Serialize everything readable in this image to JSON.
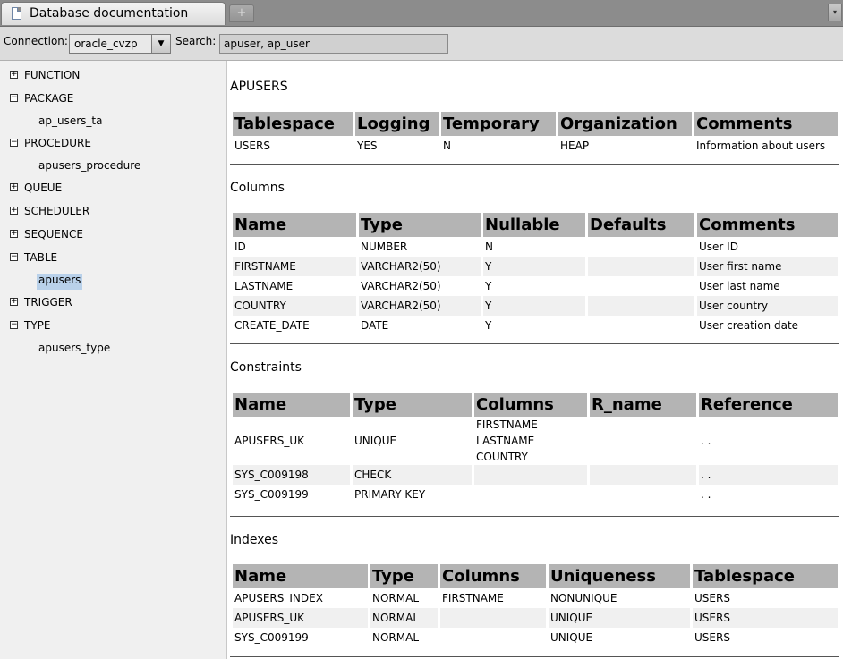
{
  "window": {
    "tab_title": "Database documentation",
    "new_tab": "+",
    "menu": "▾"
  },
  "toolbar": {
    "connection_label": "Connection:",
    "connection_value": "oracle_cvzp",
    "search_label": "Search:",
    "search_value": "apuser, ap_user"
  },
  "tree": {
    "nodes": [
      {
        "label": "FUNCTION",
        "expanded": false,
        "children": []
      },
      {
        "label": "PACKAGE",
        "expanded": true,
        "children": [
          "ap_users_ta"
        ]
      },
      {
        "label": "PROCEDURE",
        "expanded": true,
        "children": [
          "apusers_procedure"
        ]
      },
      {
        "label": "QUEUE",
        "expanded": false,
        "children": []
      },
      {
        "label": "SCHEDULER",
        "expanded": false,
        "children": []
      },
      {
        "label": "SEQUENCE",
        "expanded": false,
        "children": []
      },
      {
        "label": "TABLE",
        "expanded": true,
        "children": [
          "apusers"
        ]
      },
      {
        "label": "TRIGGER",
        "expanded": false,
        "children": []
      },
      {
        "label": "TYPE",
        "expanded": true,
        "children": [
          "apusers_type"
        ]
      }
    ],
    "selected": "apusers"
  },
  "doc": {
    "title": "APUSERS",
    "table_info": {
      "headers": [
        "Tablespace",
        "Logging",
        "Temporary",
        "Organization",
        "Comments"
      ],
      "rows": [
        [
          "USERS",
          "YES",
          "N",
          "HEAP",
          "Information about users"
        ]
      ]
    },
    "columns": {
      "title": "Columns",
      "headers": [
        "Name",
        "Type",
        "Nullable",
        "Defaults",
        "Comments"
      ],
      "rows": [
        [
          "ID",
          "NUMBER",
          "N",
          "",
          "User ID"
        ],
        [
          "FIRSTNAME",
          "VARCHAR2(50)",
          "Y",
          "",
          "User first name"
        ],
        [
          "LASTNAME",
          "VARCHAR2(50)",
          "Y",
          "",
          "User last name"
        ],
        [
          "COUNTRY",
          "VARCHAR2(50)",
          "Y",
          "",
          "User country"
        ],
        [
          "CREATE_DATE",
          "DATE",
          "Y",
          "",
          "User creation date"
        ]
      ]
    },
    "constraints": {
      "title": "Constraints",
      "headers": [
        "Name",
        "Type",
        "Columns",
        "R_name",
        "Reference"
      ],
      "rows": [
        [
          "APUSERS_UK",
          "UNIQUE",
          [
            "FIRSTNAME",
            "LASTNAME",
            "COUNTRY"
          ],
          "",
          ". ."
        ],
        [
          "SYS_C009198",
          "CHECK",
          [],
          "",
          ". ."
        ],
        [
          "SYS_C009199",
          "PRIMARY KEY",
          [],
          "",
          ". ."
        ]
      ]
    },
    "indexes": {
      "title": "Indexes",
      "headers": [
        "Name",
        "Type",
        "Columns",
        "Uniqueness",
        "Tablespace"
      ],
      "rows": [
        [
          "APUSERS_INDEX",
          "NORMAL",
          "FIRSTNAME",
          "NONUNIQUE",
          "USERS"
        ],
        [
          "APUSERS_UK",
          "NORMAL",
          "",
          "UNIQUE",
          "USERS"
        ],
        [
          "SYS_C009199",
          "NORMAL",
          "",
          "UNIQUE",
          "USERS"
        ]
      ]
    }
  },
  "colors": {
    "header_bg": "#b4b4b4",
    "selected_bg": "#b9d1ea",
    "sidebar_bg": "#f0f0f0",
    "tabbar_bg": "#8c8c8c"
  }
}
